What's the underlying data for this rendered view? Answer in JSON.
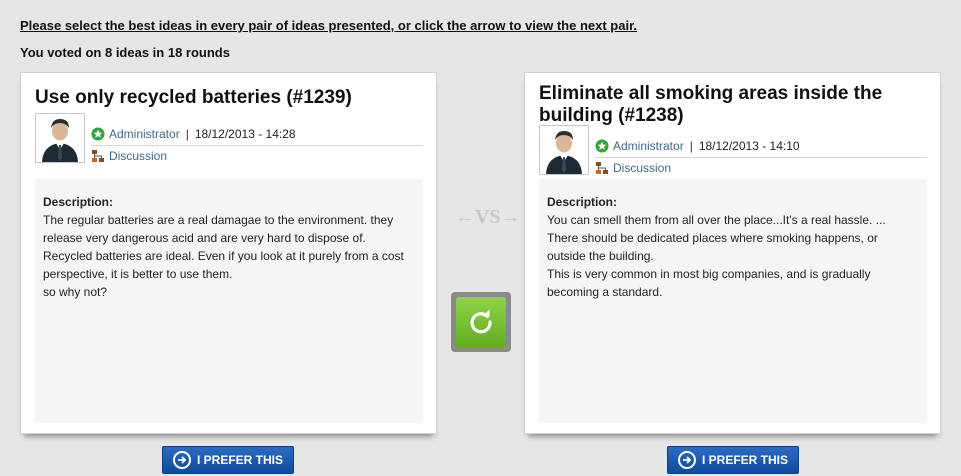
{
  "header": {
    "instruction": "Please select the best ideas in every pair of ideas presented, or click the arrow to view the next pair.",
    "stats": "You voted on 8 ideas in 18 rounds"
  },
  "ideas": [
    {
      "title": "Use only recycled batteries (#1239)",
      "author": "Administrator",
      "separator": "|",
      "date": "18/12/2013 - 14:28",
      "category": "Discussion",
      "description_label": "Description:",
      "description_lines": [
        "The regular batteries are a real damagae to the environment. they",
        "release very dangerous acid and are very hard to dispose of.",
        "Recycled batteries are ideal. Even if you look at it purely from a cost",
        "perspective, it is better to use them.",
        "so why not?"
      ]
    },
    {
      "title": "Eliminate all smoking areas inside the building (#1238)",
      "author": "Administrator",
      "separator": "|",
      "date": "18/12/2013 - 14:10",
      "category": "Discussion",
      "description_label": "Description:",
      "description_lines": [
        "You can smell them from all over the place...It's a real hassle. ...",
        "There should be dedicated places where smoking happens, or",
        "outside the building.",
        "This is very common in most big companies, and is gradually",
        "becoming a standard."
      ]
    }
  ],
  "vs_label": "←VS→",
  "prefer_label": "I PREFER THIS",
  "icons": {
    "skip": "refresh-arrow-icon",
    "prefer": "arrow-right-circle-icon",
    "avatar": "user-avatar",
    "author_badge": "admin-badge-icon",
    "category": "hierarchy-icon"
  },
  "colors": {
    "page_bg": "#e6e6e6",
    "link": "#3a6b8a",
    "button_blue": "#1a5cb4",
    "skip_green": "#7cc13a"
  }
}
